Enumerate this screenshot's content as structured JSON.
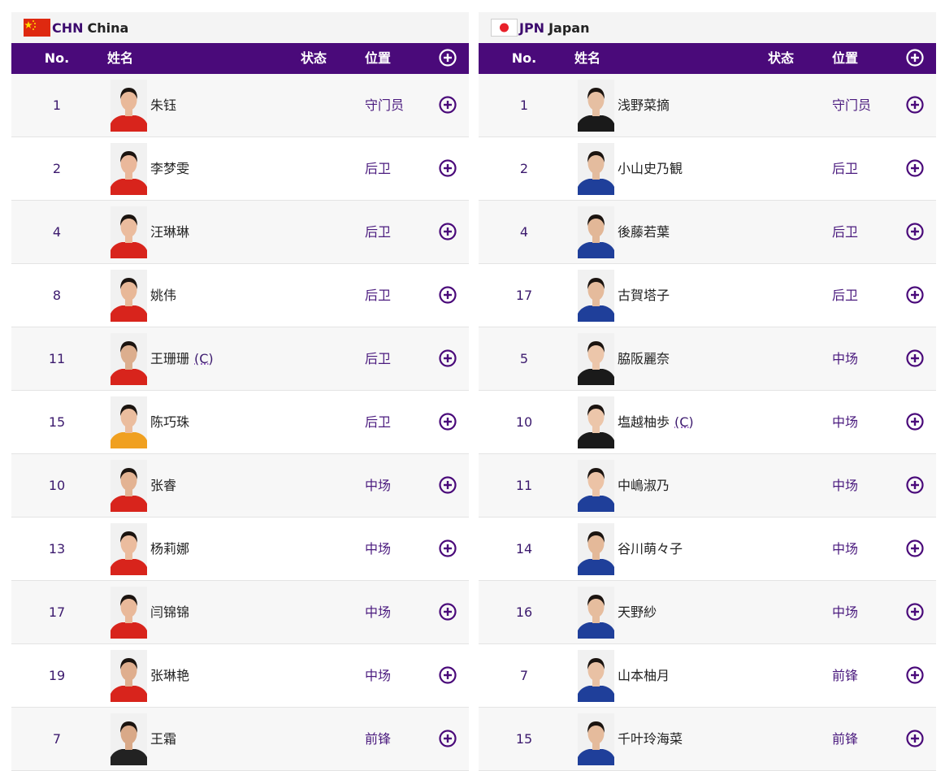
{
  "columns": {
    "no": "No.",
    "name": "姓名",
    "status": "状态",
    "position": "位置"
  },
  "colors": {
    "header_bg": "#4a0a7a",
    "accent": "#3c0a6e"
  },
  "teams": [
    {
      "code": "CHN",
      "name": "China",
      "flag_icon": "china-flag-icon",
      "kit": "red",
      "players": [
        {
          "no": "1",
          "name": "朱钰",
          "captain": "",
          "position": "守门员",
          "shirt": "#d8241c",
          "skin": "#e9b99a"
        },
        {
          "no": "2",
          "name": "李梦雯",
          "captain": "",
          "position": "后卫",
          "shirt": "#d8241c",
          "skin": "#eab89b"
        },
        {
          "no": "4",
          "name": "汪琳琳",
          "captain": "",
          "position": "后卫",
          "shirt": "#d8241c",
          "skin": "#ebbc9e"
        },
        {
          "no": "8",
          "name": "姚伟",
          "captain": "",
          "position": "后卫",
          "shirt": "#d8241c",
          "skin": "#e8b898"
        },
        {
          "no": "11",
          "name": "王珊珊",
          "captain": "(C)",
          "position": "后卫",
          "shirt": "#d8241c",
          "skin": "#dcae8e"
        },
        {
          "no": "15",
          "name": "陈巧珠",
          "captain": "",
          "position": "后卫",
          "shirt": "#f0a020",
          "skin": "#ebbd9e"
        },
        {
          "no": "10",
          "name": "张睿",
          "captain": "",
          "position": "中场",
          "shirt": "#d8241c",
          "skin": "#e3b393"
        },
        {
          "no": "13",
          "name": "杨莉娜",
          "captain": "",
          "position": "中场",
          "shirt": "#d8241c",
          "skin": "#ebbc9e"
        },
        {
          "no": "17",
          "name": "闫锦锦",
          "captain": "",
          "position": "中场",
          "shirt": "#d8241c",
          "skin": "#e9b99a"
        },
        {
          "no": "19",
          "name": "张琳艳",
          "captain": "",
          "position": "中场",
          "shirt": "#d8241c",
          "skin": "#dfae8e"
        },
        {
          "no": "7",
          "name": "王霜",
          "captain": "",
          "position": "前锋",
          "shirt": "#222222",
          "skin": "#d9a988"
        }
      ]
    },
    {
      "code": "JPN",
      "name": "Japan",
      "flag_icon": "japan-flag-icon",
      "kit": "blue",
      "players": [
        {
          "no": "1",
          "name": "浅野菜摘",
          "captain": "",
          "position": "守门员",
          "shirt": "#1a1a1a",
          "skin": "#e6bfa2"
        },
        {
          "no": "2",
          "name": "小山史乃観",
          "captain": "",
          "position": "后卫",
          "shirt": "#1f3f9a",
          "skin": "#e4bc9e"
        },
        {
          "no": "4",
          "name": "後藤若葉",
          "captain": "",
          "position": "后卫",
          "shirt": "#1f3f9a",
          "skin": "#e2b797"
        },
        {
          "no": "17",
          "name": "古賀塔子",
          "captain": "",
          "position": "后卫",
          "shirt": "#1f3f9a",
          "skin": "#e5bb9c"
        },
        {
          "no": "5",
          "name": "脇阪麗奈",
          "captain": "",
          "position": "中场",
          "shirt": "#1a1a1a",
          "skin": "#ecc6aa"
        },
        {
          "no": "10",
          "name": "塩越柚歩",
          "captain": "(C)",
          "position": "中场",
          "shirt": "#1a1a1a",
          "skin": "#ecc6aa"
        },
        {
          "no": "11",
          "name": "中嶋淑乃",
          "captain": "",
          "position": "中场",
          "shirt": "#1f3f9a",
          "skin": "#ecc3a6"
        },
        {
          "no": "14",
          "name": "谷川萌々子",
          "captain": "",
          "position": "中场",
          "shirt": "#1f3f9a",
          "skin": "#e4b999"
        },
        {
          "no": "16",
          "name": "天野紗",
          "captain": "",
          "position": "中场",
          "shirt": "#1f3f9a",
          "skin": "#e6bd9e"
        },
        {
          "no": "7",
          "name": "山本柚月",
          "captain": "",
          "position": "前锋",
          "shirt": "#1f3f9a",
          "skin": "#e9c1a4"
        },
        {
          "no": "15",
          "name": "千叶玲海菜",
          "captain": "",
          "position": "前锋",
          "shirt": "#1f3f9a",
          "skin": "#e5bb9c"
        }
      ]
    }
  ]
}
